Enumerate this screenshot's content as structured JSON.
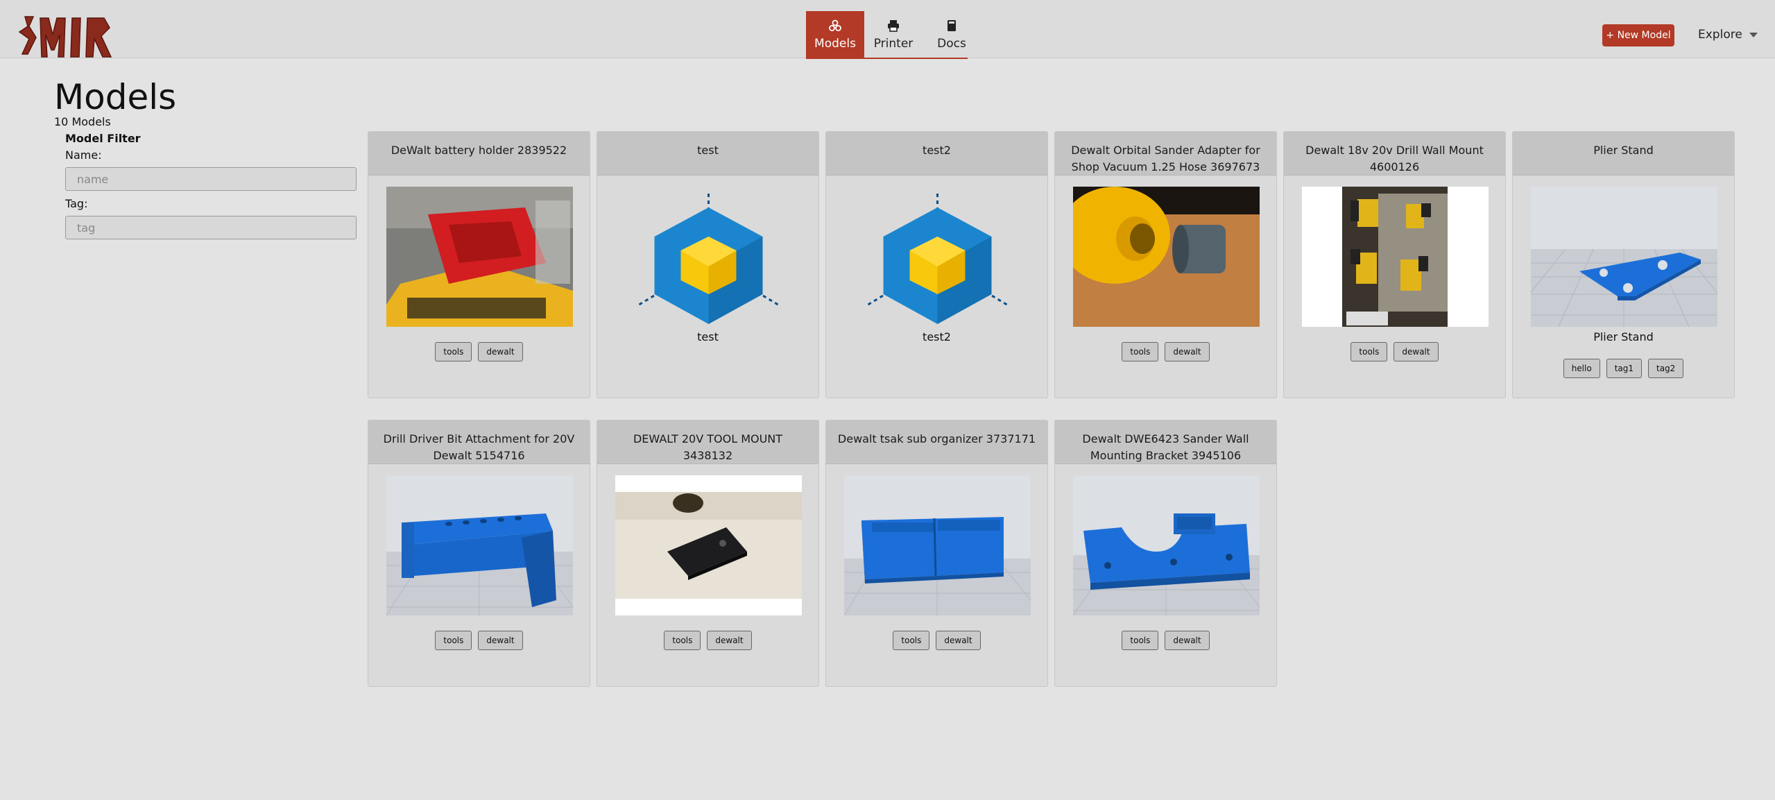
{
  "header": {
    "logo_text": "SMIR",
    "nav": [
      {
        "label": "Models",
        "icon": "models-icon",
        "active": true
      },
      {
        "label": "Printer",
        "icon": "printer-icon",
        "active": false
      },
      {
        "label": "Docs",
        "icon": "book-icon",
        "active": false
      }
    ],
    "new_model_label": "+ New Model",
    "explore_label": "Explore"
  },
  "page": {
    "title": "Models",
    "count": "10 Models"
  },
  "filter": {
    "title": "Model Filter",
    "name_label": "Name:",
    "name_placeholder": "name",
    "tag_label": "Tag:",
    "tag_placeholder": "tag"
  },
  "models": [
    {
      "title": "DeWalt battery holder 2839522",
      "image": "red-battery-holder-photo",
      "caption": "",
      "tags": [
        "tools",
        "dewalt"
      ]
    },
    {
      "title": "test",
      "image": "placeholder-cube-icon",
      "caption": "test",
      "tags": []
    },
    {
      "title": "test2",
      "image": "placeholder-cube-icon",
      "caption": "test2",
      "tags": []
    },
    {
      "title": "Dewalt Orbital Sander Adapter for Shop Vacuum 1.25 Hose 3697673",
      "image": "sander-adapter-photo",
      "caption": "",
      "tags": [
        "tools",
        "dewalt"
      ]
    },
    {
      "title": "Dewalt 18v 20v Drill Wall Mount 4600126",
      "image": "drill-wall-mount-photo",
      "caption": "",
      "tags": [
        "tools",
        "dewalt"
      ]
    },
    {
      "title": "Plier Stand",
      "image": "plier-stand-render",
      "caption": "Plier Stand",
      "tags": [
        "hello",
        "tag1",
        "tag2"
      ]
    },
    {
      "title": "Drill Driver Bit Attachment for 20V Dewalt 5154716",
      "image": "bit-attachment-render",
      "caption": "",
      "tags": [
        "tools",
        "dewalt"
      ]
    },
    {
      "title": "DEWALT 20V TOOL MOUNT 3438132",
      "image": "tool-mount-photo",
      "caption": "",
      "tags": [
        "tools",
        "dewalt"
      ]
    },
    {
      "title": "Dewalt tsak sub organizer 3737171",
      "image": "organizer-render",
      "caption": "",
      "tags": [
        "tools",
        "dewalt"
      ]
    },
    {
      "title": "Dewalt DWE6423 Sander Wall Mounting Bracket 3945106",
      "image": "sander-bracket-render",
      "caption": "",
      "tags": [
        "tools",
        "dewalt"
      ]
    }
  ],
  "colors": {
    "accent": "#b23a26",
    "background": "#e3e3e3",
    "card_header": "#c4c4c4"
  }
}
